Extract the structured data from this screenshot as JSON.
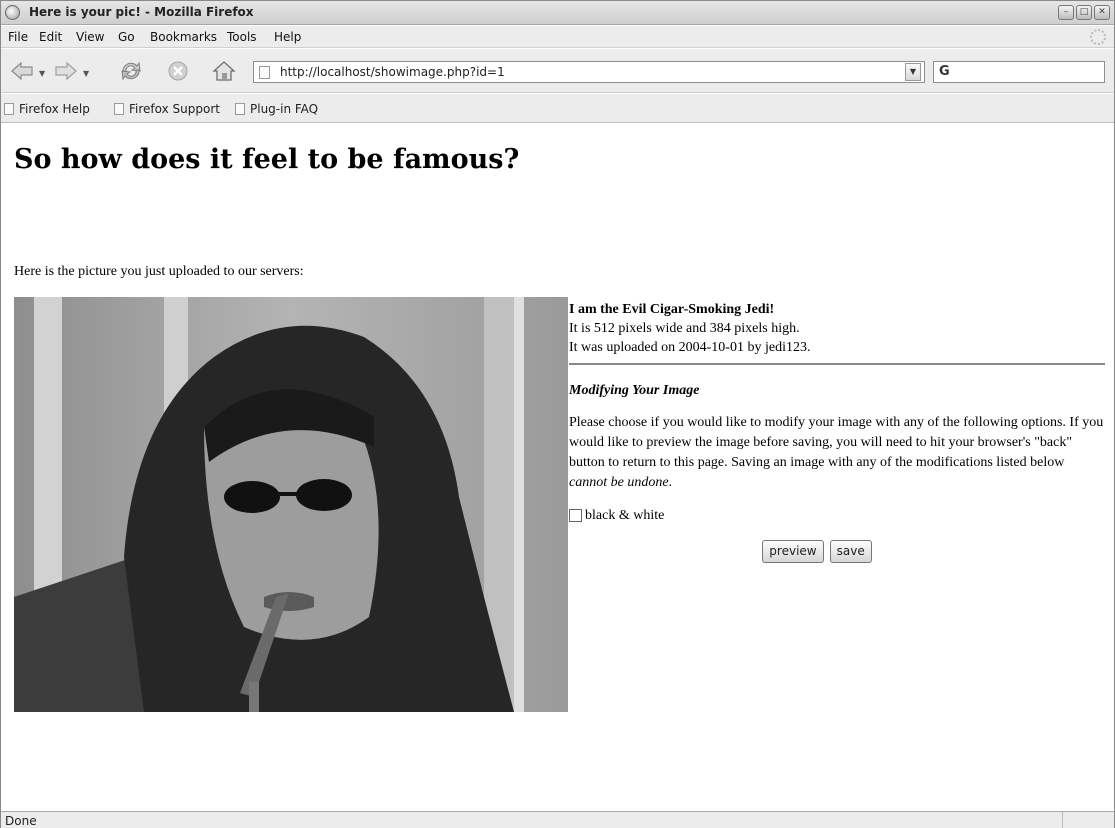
{
  "window": {
    "title": "Here is your pic! - Mozilla Firefox",
    "minimize_label": "–",
    "maximize_label": "□",
    "close_label": "✕"
  },
  "menu": {
    "items": [
      "File",
      "Edit",
      "View",
      "Go",
      "Bookmarks",
      "Tools",
      "Help"
    ]
  },
  "toolbar": {
    "url": "http://localhost/showimage.php?id=1",
    "search_placeholder": "",
    "search_icon_label": "G"
  },
  "bookmarks": {
    "items": [
      "Firefox Help",
      "Firefox Support",
      "Plug-in FAQ"
    ]
  },
  "page": {
    "heading": "So how does it feel to be famous?",
    "intro": "Here is the picture you just uploaded to our servers:",
    "caption": "I am the Evil Cigar-Smoking Jedi!",
    "dimensions_line": "It is 512 pixels wide and 384 pixels high.",
    "upload_line": "It was uploaded on 2004-10-01 by jedi123.",
    "section_title": "Modifying Your Image",
    "instructions": "Please choose if you would like to modify your image with any of the following options. If you would like to preview the image before saving, you will need to hit your browser's \"back\" button to return to this page. Saving an image with any of the modifications listed below",
    "instructions_emphasis": "cannot be undone",
    "instructions_end": ".",
    "option_label": "black & white",
    "preview_label": "preview",
    "save_label": "save"
  },
  "status": {
    "text": "Done"
  }
}
